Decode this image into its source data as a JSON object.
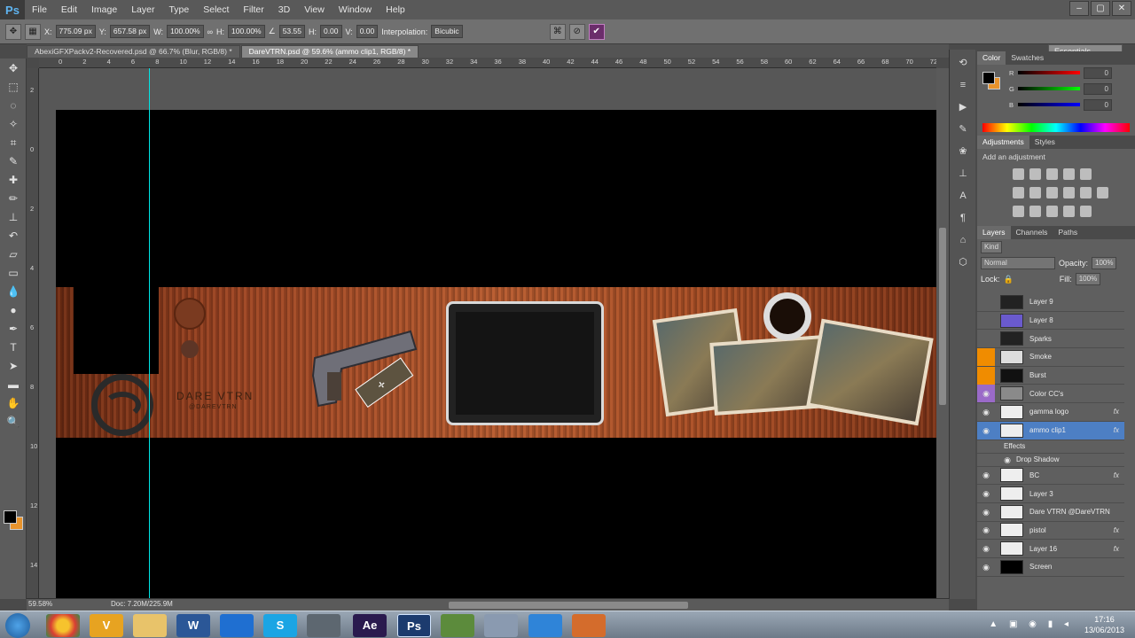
{
  "menubar": {
    "logo": "Ps",
    "items": [
      "File",
      "Edit",
      "Image",
      "Layer",
      "Type",
      "Select",
      "Filter",
      "3D",
      "View",
      "Window",
      "Help"
    ],
    "window_controls": [
      "–",
      "▢",
      "✕"
    ]
  },
  "options": {
    "x_label": "X:",
    "x": "775.09 px",
    "y_label": "Y:",
    "y": "657.58 px",
    "w_label": "W:",
    "w": "100.00%",
    "h_label": "H:",
    "h": "100.00%",
    "angle": "53.55",
    "h_skew_label": "H:",
    "h_skew": "0.00",
    "v_skew_label": "V:",
    "v_skew": "0.00",
    "interp_label": "Interpolation:",
    "interp": "Bicubic",
    "workspace": "Essentials"
  },
  "tabs": [
    {
      "label": "AbexiGFXPackv2-Recovered.psd @ 66.7% (Blur, RGB/8) *"
    },
    {
      "label": "DareVTRN.psd @ 59.6% (ammo clip1, RGB/8) *"
    }
  ],
  "ruler": {
    "h_ticks": [
      "0",
      "2",
      "4",
      "6",
      "8",
      "10",
      "12",
      "14",
      "16",
      "18",
      "20",
      "22",
      "24",
      "26",
      "28",
      "30",
      "32",
      "34",
      "36",
      "38",
      "40",
      "42",
      "44",
      "46",
      "48",
      "50",
      "52",
      "54",
      "56",
      "58",
      "60",
      "62",
      "64",
      "66",
      "68",
      "70",
      "72"
    ],
    "v_ticks": [
      "2",
      "0",
      "2",
      "4",
      "6",
      "8",
      "10",
      "12",
      "14"
    ]
  },
  "canvas": {
    "brand": "DARE VTRN",
    "brand_sub": "@DAREVTRN"
  },
  "status": {
    "zoom": "59.58%",
    "doc": "Doc: 7.20M/225.9M"
  },
  "panels": {
    "color_tabs": [
      "Color",
      "Swatches"
    ],
    "rgb": [
      {
        "label": "R",
        "value": "0"
      },
      {
        "label": "G",
        "value": "0"
      },
      {
        "label": "B",
        "value": "0"
      }
    ],
    "adj_tabs": [
      "Adjustments",
      "Styles"
    ],
    "adj_title": "Add an adjustment",
    "layer_tabs": [
      "Layers",
      "Channels",
      "Paths"
    ],
    "kind": "Kind",
    "blend": "Normal",
    "opacity_label": "Opacity:",
    "opacity": "100%",
    "lock_label": "Lock:",
    "fill_label": "Fill:",
    "fill": "100%",
    "layers": [
      {
        "name": "Layer 9",
        "eye": false,
        "fx": ""
      },
      {
        "name": "Layer 8",
        "eye": false,
        "fx": ""
      },
      {
        "name": "Sparks",
        "eye": false,
        "fx": ""
      },
      {
        "name": "Smoke",
        "eye": false,
        "fx": ""
      },
      {
        "name": "Burst",
        "eye": false,
        "fx": ""
      },
      {
        "name": "Color CC's",
        "eye": true,
        "fx": ""
      },
      {
        "name": "gamma logo",
        "eye": true,
        "fx": "fx"
      },
      {
        "name": "ammo clip1",
        "eye": true,
        "fx": "fx"
      },
      {
        "name": "Effects",
        "eye": false,
        "fx": ""
      },
      {
        "name": "Drop Shadow",
        "eye": true,
        "fx": ""
      },
      {
        "name": "BC",
        "eye": true,
        "fx": "fx"
      },
      {
        "name": "Layer 3",
        "eye": true,
        "fx": ""
      },
      {
        "name": "Dare VTRN @DareVTRN",
        "eye": true,
        "fx": ""
      },
      {
        "name": "pistol",
        "eye": true,
        "fx": "fx"
      },
      {
        "name": "Layer 16",
        "eye": true,
        "fx": "fx"
      },
      {
        "name": "Screen",
        "eye": true,
        "fx": ""
      }
    ]
  },
  "taskbar": {
    "time": "17:16",
    "date": "13/06/2013"
  }
}
